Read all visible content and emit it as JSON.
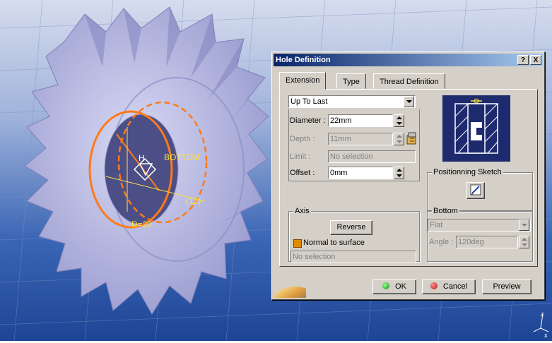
{
  "viewport": {
    "dimension_primary": "D=22",
    "dimension_secondary": "(12)",
    "label_bottom": "BOTTOM",
    "label_h": "H",
    "axis_z": "z",
    "axis_x": "x"
  },
  "dialog": {
    "title": "Hole Definition",
    "help_label": "?",
    "close_label": "X",
    "tabs": [
      {
        "label": "Extension",
        "active": true
      },
      {
        "label": "Type",
        "active": false
      },
      {
        "label": "Thread Definition",
        "active": false
      }
    ],
    "extension": {
      "limit_type": "Up To Last",
      "diameter_label": "Diameter :",
      "diameter_value": "22mm",
      "depth_label": "Depth :",
      "depth_value": "11mm",
      "limit_label": "Limit :",
      "limit_value": "No selection",
      "offset_label": "Offset :",
      "offset_value": "0mm"
    },
    "positioning": {
      "title": "Positionning Sketch"
    },
    "axis": {
      "title": "Axis",
      "reverse_label": "Reverse",
      "normal_label": "Normal to surface",
      "normal_checked": true,
      "selection_value": "No selection"
    },
    "bottom": {
      "title": "Bottom",
      "type_value": "Flat",
      "angle_label": "Angle :",
      "angle_value": "120deg"
    },
    "buttons": {
      "ok_label": "OK",
      "cancel_label": "Cancel",
      "preview_label": "Preview"
    }
  },
  "colors": {
    "background_top": "#c8d0e4",
    "background_bottom": "#1e4a9c",
    "part_color": "#b6b8e2",
    "highlight": "#ff7a1a",
    "dimension_text": "#ffe23a",
    "title_bar": "#0a246a"
  }
}
